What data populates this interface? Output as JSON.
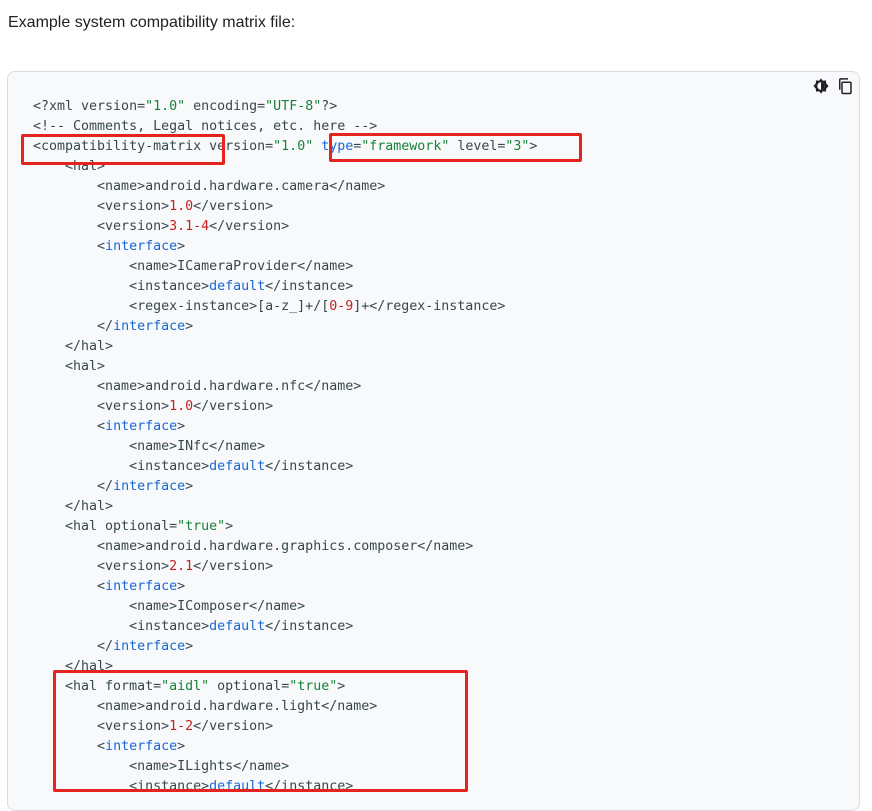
{
  "intro": "Example system compatibility matrix file:",
  "icons": {
    "theme": "theme-toggle-icon",
    "copy": "copy-icon"
  },
  "colors": {
    "tag": "#37474f",
    "string": "#188038",
    "keyword": "#1967d2",
    "number": "#c5221f",
    "highlight": "#e5231f"
  },
  "code": [
    [
      [
        "t",
        "<?xml version="
      ],
      [
        "s",
        "\"1.0\""
      ],
      [
        "t",
        " encoding="
      ],
      [
        "s",
        "\"UTF-8\""
      ],
      [
        "t",
        "?>"
      ]
    ],
    [
      [
        "c",
        "<!-- Comments, Legal notices, etc. here -->"
      ]
    ],
    [
      [
        "t",
        "<compatibility-matrix version="
      ],
      [
        "s",
        "\"1.0\""
      ],
      [
        "t",
        " "
      ],
      [
        "k",
        "type"
      ],
      [
        "t",
        "="
      ],
      [
        "s",
        "\"framework\""
      ],
      [
        "t",
        " level="
      ],
      [
        "s",
        "\"3\""
      ],
      [
        "t",
        ">"
      ]
    ],
    [
      [
        "t",
        "    <hal>"
      ]
    ],
    [
      [
        "t",
        "        <name>android.hardware.camera</name>"
      ]
    ],
    [
      [
        "t",
        "        <version>"
      ],
      [
        "n",
        "1.0"
      ],
      [
        "t",
        "</version>"
      ]
    ],
    [
      [
        "t",
        "        <version>"
      ],
      [
        "n",
        "3.1-4"
      ],
      [
        "t",
        "</version>"
      ]
    ],
    [
      [
        "t",
        "        <"
      ],
      [
        "k",
        "interface"
      ],
      [
        "t",
        ">"
      ]
    ],
    [
      [
        "t",
        "            <name>ICameraProvider</name>"
      ]
    ],
    [
      [
        "t",
        "            <instance>"
      ],
      [
        "k",
        "default"
      ],
      [
        "t",
        "</instance>"
      ]
    ],
    [
      [
        "t",
        "            <regex-instance>[a-z_]+/["
      ],
      [
        "n",
        "0-9"
      ],
      [
        "t",
        "]+</regex-instance>"
      ]
    ],
    [
      [
        "t",
        "        </"
      ],
      [
        "k",
        "interface"
      ],
      [
        "t",
        ">"
      ]
    ],
    [
      [
        "t",
        "    </hal>"
      ]
    ],
    [
      [
        "t",
        "    <hal>"
      ]
    ],
    [
      [
        "t",
        "        <name>android.hardware.nfc</name>"
      ]
    ],
    [
      [
        "t",
        "        <version>"
      ],
      [
        "n",
        "1.0"
      ],
      [
        "t",
        "</version>"
      ]
    ],
    [
      [
        "t",
        "        <"
      ],
      [
        "k",
        "interface"
      ],
      [
        "t",
        ">"
      ]
    ],
    [
      [
        "t",
        "            <name>INfc</name>"
      ]
    ],
    [
      [
        "t",
        "            <instance>"
      ],
      [
        "k",
        "default"
      ],
      [
        "t",
        "</instance>"
      ]
    ],
    [
      [
        "t",
        "        </"
      ],
      [
        "k",
        "interface"
      ],
      [
        "t",
        ">"
      ]
    ],
    [
      [
        "t",
        "    </hal>"
      ]
    ],
    [
      [
        "t",
        "    <hal optional="
      ],
      [
        "s",
        "\"true\""
      ],
      [
        "t",
        ">"
      ]
    ],
    [
      [
        "t",
        "        <name>android.hardware.graphics.composer</name>"
      ]
    ],
    [
      [
        "t",
        "        <version>"
      ],
      [
        "n",
        "2.1"
      ],
      [
        "t",
        "</version>"
      ]
    ],
    [
      [
        "t",
        "        <"
      ],
      [
        "k",
        "interface"
      ],
      [
        "t",
        ">"
      ]
    ],
    [
      [
        "t",
        "            <name>IComposer</name>"
      ]
    ],
    [
      [
        "t",
        "            <instance>"
      ],
      [
        "k",
        "default"
      ],
      [
        "t",
        "</instance>"
      ]
    ],
    [
      [
        "t",
        "        </"
      ],
      [
        "k",
        "interface"
      ],
      [
        "t",
        ">"
      ]
    ],
    [
      [
        "t",
        "    </hal>"
      ]
    ],
    [
      [
        "t",
        "    <hal format="
      ],
      [
        "s",
        "\"aidl\""
      ],
      [
        "t",
        " optional="
      ],
      [
        "s",
        "\"true\""
      ],
      [
        "t",
        ">"
      ]
    ],
    [
      [
        "t",
        "        <name>android.hardware.light</name>"
      ]
    ],
    [
      [
        "t",
        "        <version>"
      ],
      [
        "n",
        "1-2"
      ],
      [
        "t",
        "</version>"
      ]
    ],
    [
      [
        "t",
        "        <"
      ],
      [
        "k",
        "interface"
      ],
      [
        "t",
        ">"
      ]
    ],
    [
      [
        "t",
        "            <name>ILights</name>"
      ]
    ],
    [
      [
        "t",
        "            <instance>"
      ],
      [
        "k",
        "default"
      ],
      [
        "t",
        "</instance>"
      ]
    ]
  ]
}
